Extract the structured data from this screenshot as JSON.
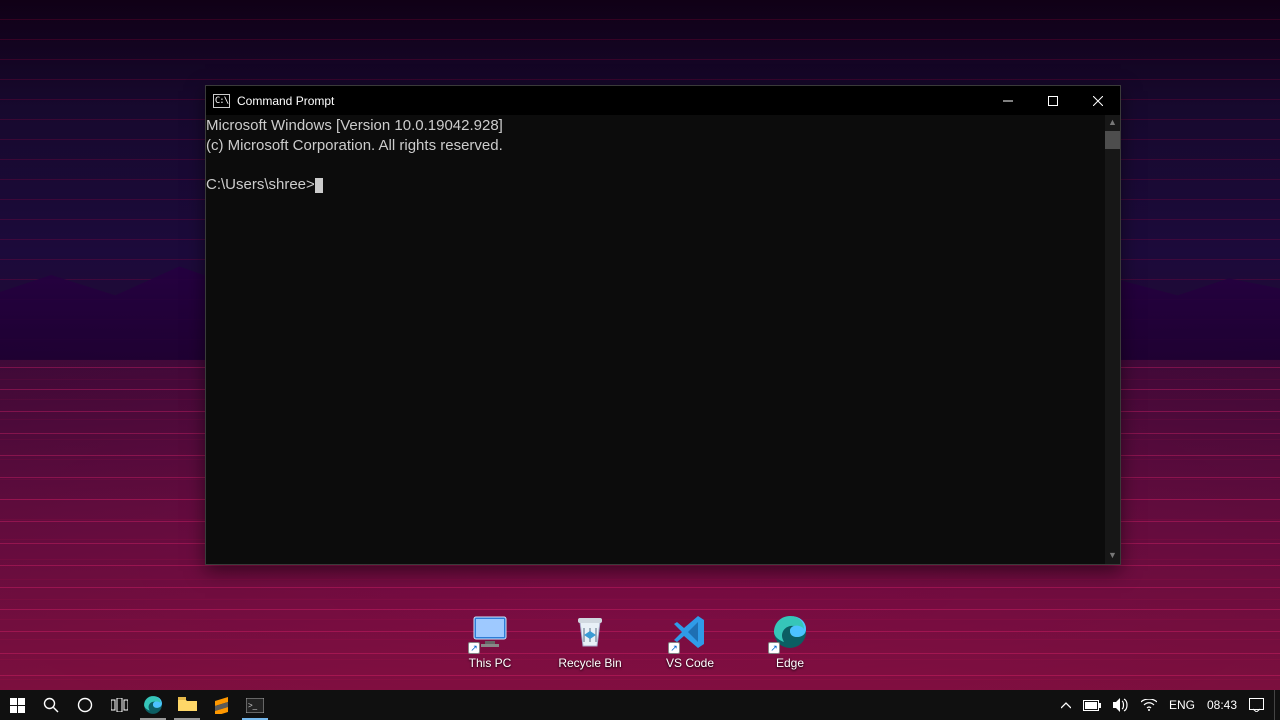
{
  "window": {
    "title": "Command Prompt",
    "icon_label": "C:\\"
  },
  "terminal": {
    "line1": "Microsoft Windows [Version 10.0.19042.928]",
    "line2": "(c) Microsoft Corporation. All rights reserved.",
    "prompt": "C:\\Users\\shree>"
  },
  "desktop_icons": {
    "this_pc": "This PC",
    "recycle_bin": "Recycle Bin",
    "vs_code": "VS Code",
    "edge": "Edge"
  },
  "taskbar": {
    "language": "ENG",
    "time": "08:43"
  }
}
